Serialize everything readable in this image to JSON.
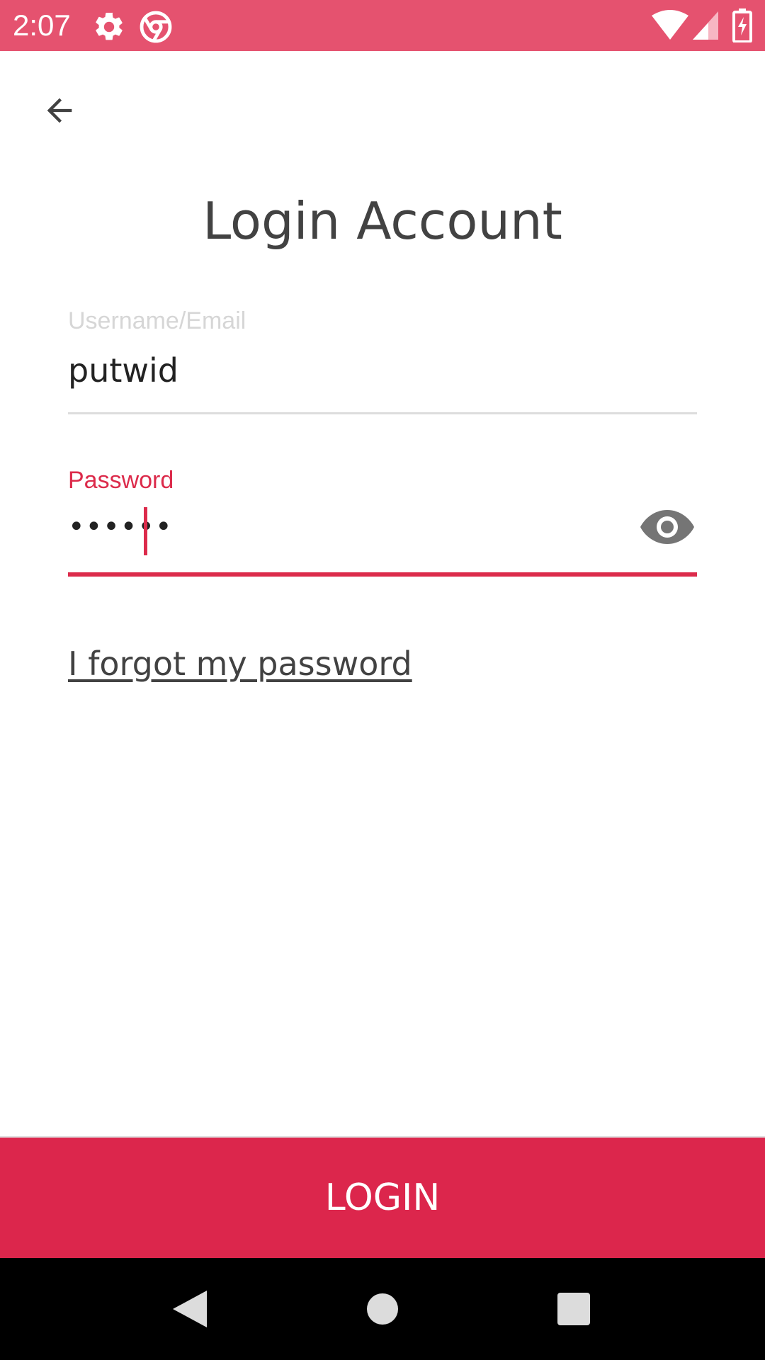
{
  "status_bar": {
    "time": "2:07",
    "icons": [
      "gear-icon",
      "chrome-icon",
      "wifi-icon",
      "signal-icon",
      "battery-icon"
    ],
    "background": "#e5526f"
  },
  "header": {
    "back_icon": "arrow-left-icon"
  },
  "main": {
    "title": "Login Account",
    "username": {
      "label": "Username/Email",
      "value": "putwid"
    },
    "password": {
      "label": "Password",
      "masked_value": "••••••",
      "toggle_icon": "eye-icon"
    },
    "forgot_link": "I forgot my password"
  },
  "footer": {
    "login_label": "LOGIN"
  },
  "nav_bar": {
    "icons": [
      "nav-back-icon",
      "nav-home-icon",
      "nav-recents-icon"
    ]
  },
  "colors": {
    "accent": "#dc264c",
    "status_bar": "#e5526f",
    "text_dark": "#424242",
    "label_inactive": "#d6d6d6"
  }
}
